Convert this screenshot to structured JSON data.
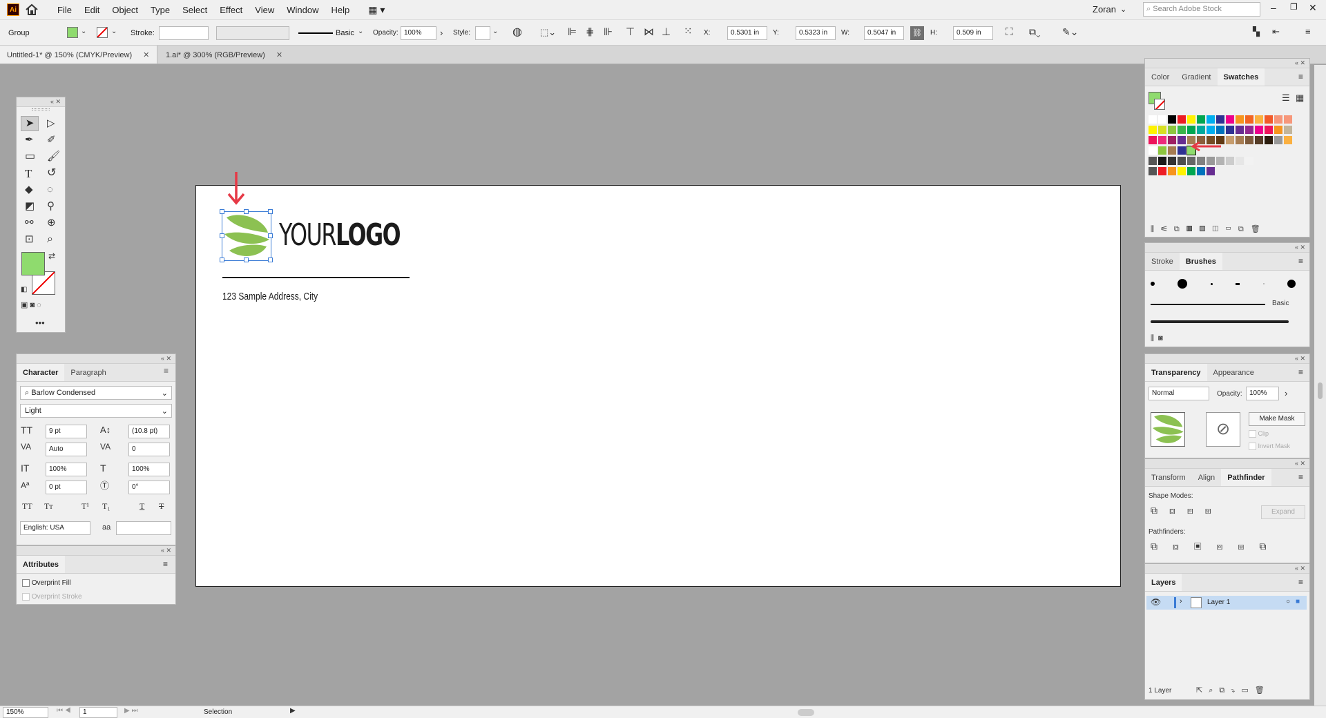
{
  "menu": {
    "app_icon": "Ai",
    "items": [
      "File",
      "Edit",
      "Object",
      "Type",
      "Select",
      "Effect",
      "View",
      "Window",
      "Help"
    ],
    "user": "Zoran",
    "search_placeholder": "Search Adobe Stock"
  },
  "control": {
    "selection_type": "Group",
    "stroke_label": "Stroke:",
    "brush": "Basic",
    "opacity_label": "Opacity:",
    "opacity": "100%",
    "style_label": "Style:",
    "x_label": "X:",
    "x": "0.5301 in",
    "y_label": "Y:",
    "y": "0.5323 in",
    "w_label": "W:",
    "w": "0.5047 in",
    "h_label": "H:",
    "h": "0.509 in",
    "fill_color": "#8fdb6e"
  },
  "doc_tabs": [
    {
      "label": "Untitled-1* @ 150% (CMYK/Preview)",
      "active": true
    },
    {
      "label": "1.ai* @ 300% (RGB/Preview)",
      "active": false
    }
  ],
  "artboard": {
    "logo_regular": "YOUR",
    "logo_bold": "LOGO",
    "address": "123 Sample Address, City",
    "leaf_color": "#8cc152",
    "arrow_color": "#e63946"
  },
  "character": {
    "tab1": "Character",
    "tab2": "Paragraph",
    "font": "Barlow Condensed",
    "style": "Light",
    "size": "9 pt",
    "leading": "(10.8 pt)",
    "kerning": "Auto",
    "tracking": "0",
    "vscale": "100%",
    "hscale": "100%",
    "baseline": "0 pt",
    "rotation": "0°",
    "language": "English: USA",
    "aa": "aa"
  },
  "attributes": {
    "title": "Attributes",
    "overprint_fill": "Overprint Fill",
    "overprint_stroke": "Overprint Stroke"
  },
  "swatches": {
    "tabs": [
      "Color",
      "Gradient",
      "Swatches"
    ]
  },
  "brushes": {
    "tabs": [
      "Stroke",
      "Brushes"
    ],
    "basic": "Basic"
  },
  "transparency": {
    "tabs": [
      "Transparency",
      "Appearance"
    ],
    "blend": "Normal",
    "opacity_label": "Opacity:",
    "opacity": "100%",
    "make_mask": "Make Mask",
    "clip": "Clip",
    "invert": "Invert Mask"
  },
  "pathfinder": {
    "tabs": [
      "Transform",
      "Align",
      "Pathfinder"
    ],
    "shape_modes": "Shape Modes:",
    "pathfinders": "Pathfinders:",
    "expand": "Expand"
  },
  "layers": {
    "title": "Layers",
    "layer1": "Layer 1",
    "count": "1 Layer"
  },
  "status": {
    "zoom": "150%",
    "artboard": "1",
    "tool": "Selection"
  }
}
